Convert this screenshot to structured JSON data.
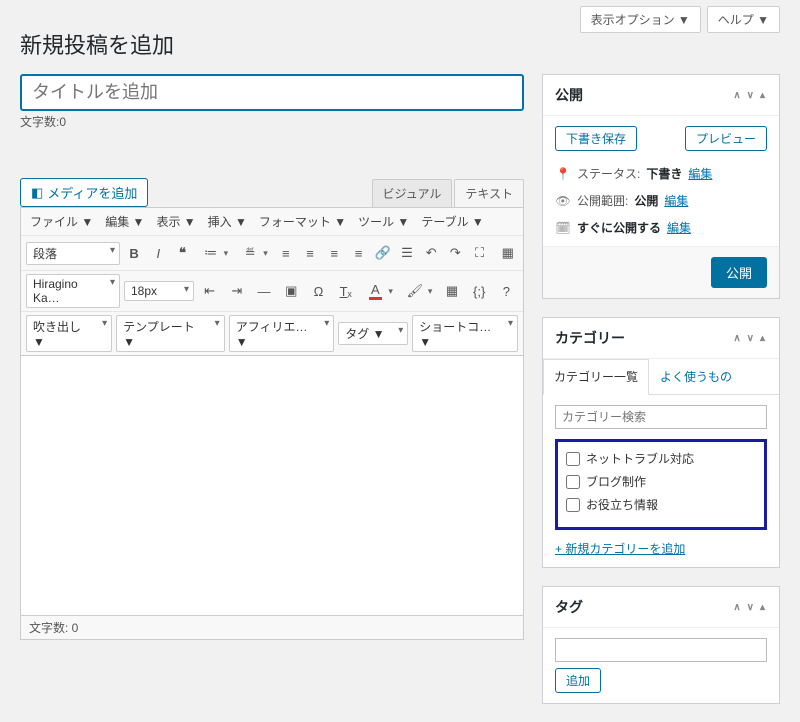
{
  "top_controls": {
    "screen_options": "表示オプション ▼",
    "help": "ヘルプ ▼"
  },
  "page_title": "新規投稿を追加",
  "title_placeholder": "タイトルを追加",
  "word_count_top": "文字数:0",
  "media_button": "メディアを追加",
  "editor_tabs": {
    "visual": "ビジュアル",
    "text": "テキスト"
  },
  "menubar": {
    "file": "ファイル ▼",
    "edit": "編集 ▼",
    "view": "表示 ▼",
    "insert": "挿入 ▼",
    "format": "フォーマット ▼",
    "tools": "ツール ▼",
    "table": "テーブル ▼"
  },
  "toolbar1": {
    "format_select": "段落"
  },
  "toolbar2": {
    "font_select": "Hiragino Ka…",
    "size_select": "18px"
  },
  "toolbar3": {
    "balloon": "吹き出し ▼",
    "template": "テンプレート ▼",
    "affiliate": "アフィリエ…▼",
    "tag": "タグ ▼",
    "shortcode": "ショートコ…▼"
  },
  "status_bar": "文字数: 0",
  "publish": {
    "heading": "公開",
    "save_draft": "下書き保存",
    "preview": "プレビュー",
    "status_label": "ステータス:",
    "status_value": "下書き",
    "status_edit": "編集",
    "visibility_label": "公開範囲:",
    "visibility_value": "公開",
    "visibility_edit": "編集",
    "schedule_label": "すぐに公開する",
    "schedule_edit": "編集",
    "publish_btn": "公開"
  },
  "category": {
    "heading": "カテゴリー",
    "tab_all": "カテゴリー一覧",
    "tab_most": "よく使うもの",
    "search_placeholder": "カテゴリー検索",
    "items": [
      "ネットトラブル対応",
      "ブログ制作",
      "お役立ち情報"
    ],
    "add_new": "+ 新規カテゴリーを追加"
  },
  "tag": {
    "heading": "タグ",
    "add_btn": "追加"
  }
}
